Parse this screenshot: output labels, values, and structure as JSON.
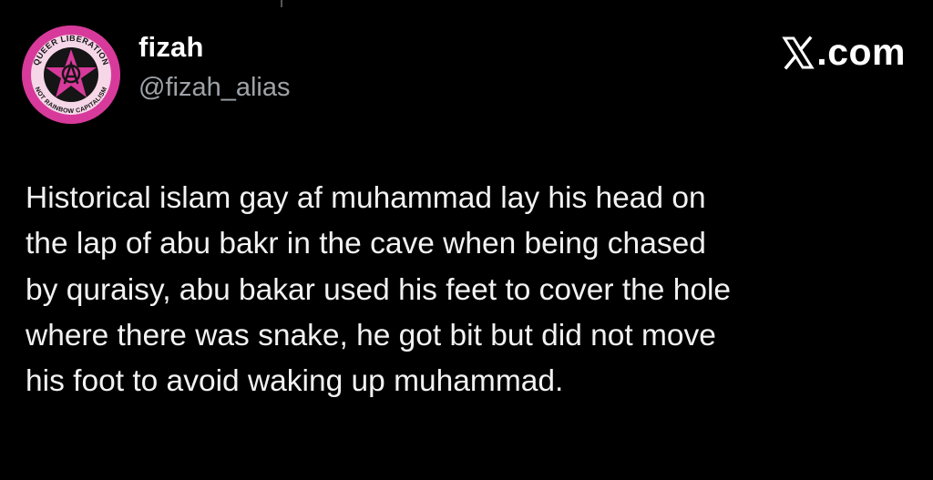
{
  "author": {
    "display_name": "fizah",
    "handle": "@fizah_alias",
    "avatar": {
      "icon": "anarchy-star-badge-icon",
      "badge_text_top": "QUEER LIBERATION",
      "badge_text_bottom": "NOT RAINBOW CAPITALISM",
      "colors": {
        "ring": "#d73a9a",
        "inner": "#1a1a1a",
        "star": "#d73a9a"
      }
    }
  },
  "brand": {
    "icon": "x-logo-icon",
    "label": ".com"
  },
  "tweet": {
    "lines": [
      "Historical islam gay af muhammad lay his head on",
      "the lap of abu bakr in the cave when being chased",
      "by quraisy, abu bakar used his feet to cover the hole",
      "where there was snake, he got bit but did not move",
      "his foot to avoid waking up muhammad."
    ]
  },
  "colors": {
    "background": "#000000",
    "text": "#f2f2f2",
    "handle": "#9ea3a8"
  }
}
